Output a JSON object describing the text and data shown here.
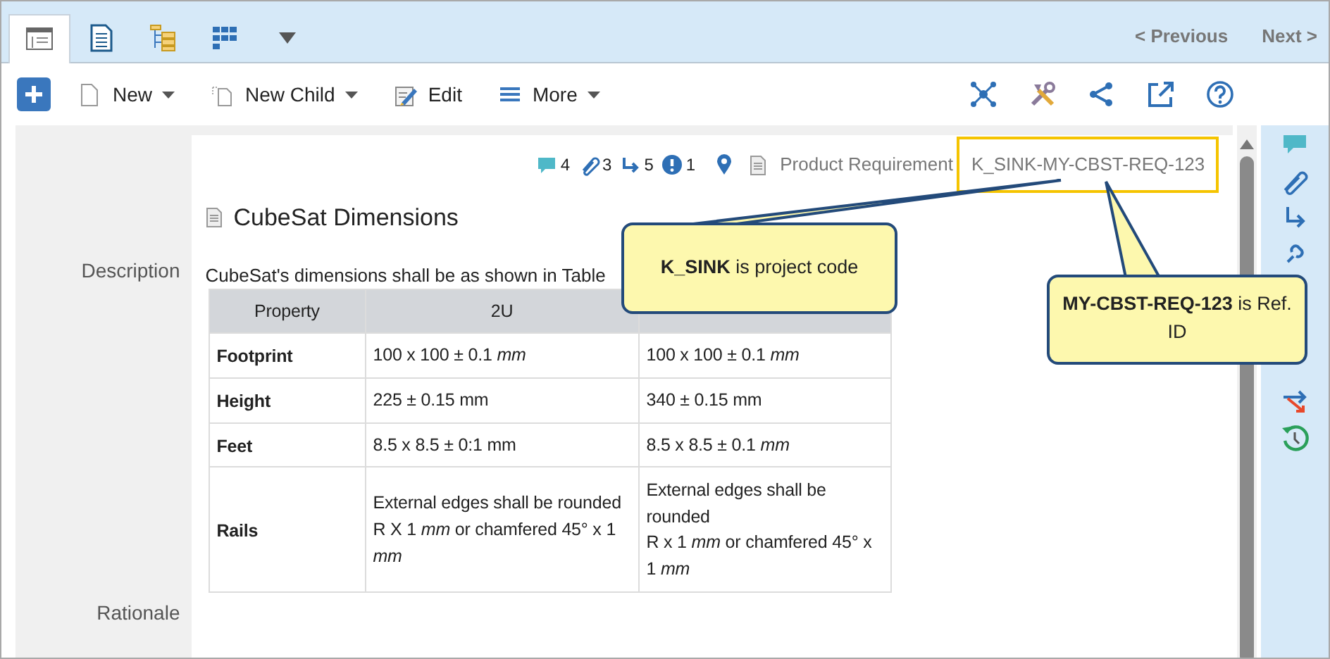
{
  "tabs": [
    {
      "kind": "form",
      "selected": true
    },
    {
      "kind": "document",
      "selected": false
    },
    {
      "kind": "tree",
      "selected": false
    },
    {
      "kind": "grid",
      "selected": false
    }
  ],
  "pager": {
    "previous": "< Previous",
    "next": "Next >"
  },
  "toolbar": [
    {
      "kind": "add"
    },
    {
      "kind": "new",
      "label": "New",
      "dropdown": true
    },
    {
      "kind": "child",
      "label": "New Child",
      "dropdown": true
    },
    {
      "kind": "edit",
      "label": "Edit",
      "dropdown": false
    },
    {
      "kind": "more",
      "label": "More",
      "dropdown": true
    }
  ],
  "counters": [
    {
      "kind": "comment",
      "count": "4"
    },
    {
      "kind": "attachment",
      "count": "3"
    },
    {
      "kind": "link",
      "count": "5"
    },
    {
      "kind": "issue",
      "count": "1"
    }
  ],
  "item_type": "Product Requirement",
  "ref_id": "K_SINK-MY-CBST-REQ-123",
  "title": "CubeSat Dimensions",
  "description": {
    "label": "Description",
    "intro": "CubeSat's dimensions shall be as shown in Table",
    "columns": [
      "Property",
      "2U"
    ],
    "rows": [
      [
        "Footprint",
        "100 x 100 ± 0.1 *mm*",
        "100 x 100 ± 0.1 *mm*"
      ],
      [
        "Height",
        "225 ± 0.15 mm",
        "340 ± 0.15 mm"
      ],
      [
        "Feet",
        "8.5 x 8.5 ± 0:1 mm",
        "8.5 x 8.5 ± 0.1 *mm*"
      ],
      [
        "Rails",
        "External edges shall be rounded R X 1 *mm* or chamfered 45° x 1 *mm*",
        "External edges shall be rounded\nR x 1 *mm* or chamfered 45° x 1 *mm*"
      ]
    ]
  },
  "rationale": {
    "label": "Rationale"
  },
  "callouts": [
    {
      "text": "**K_SINK** is project code"
    },
    {
      "text": "**MY-CBST-REQ-123** is Ref. ID"
    }
  ]
}
